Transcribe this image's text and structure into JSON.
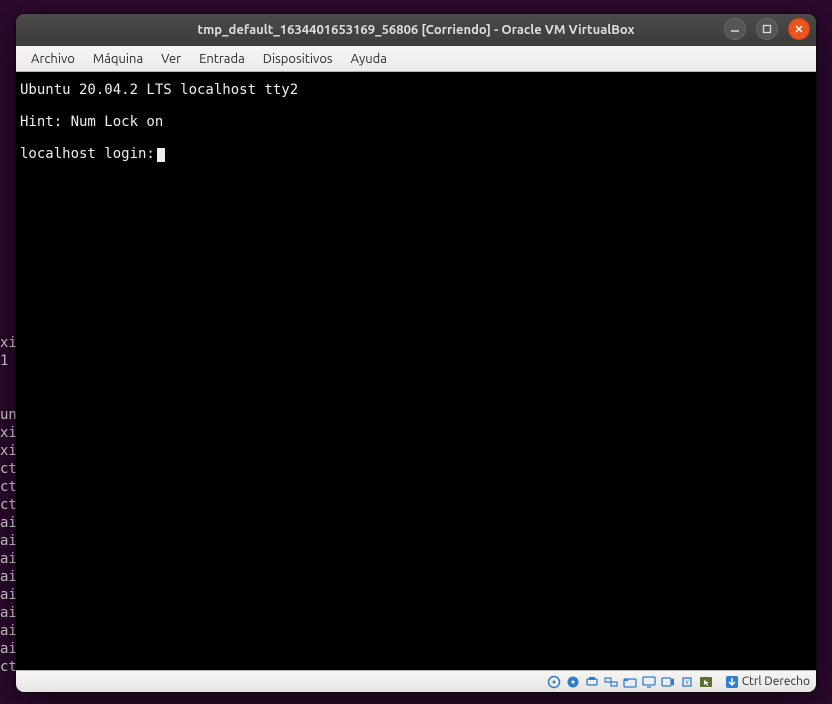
{
  "background_lines": "\n\n\nxi\n1\n\n\nun\nxi\nxi\nct\nct\nct\nai\nai\nai\nai\nai\nai\nai\nai\nct",
  "window": {
    "title": "tmp_default_1634401653169_56806 [Corriendo] - Oracle VM VirtualBox"
  },
  "menu": {
    "archivo": "Archivo",
    "maquina": "Máquina",
    "ver": "Ver",
    "entrada": "Entrada",
    "dispositivos": "Dispositivos",
    "ayuda": "Ayuda"
  },
  "console": {
    "line1": "Ubuntu 20.04.2 LTS localhost tty2",
    "line2": "Hint: Num Lock on",
    "prompt": "localhost login:"
  },
  "statusbar": {
    "hostkey": "Ctrl Derecho"
  }
}
